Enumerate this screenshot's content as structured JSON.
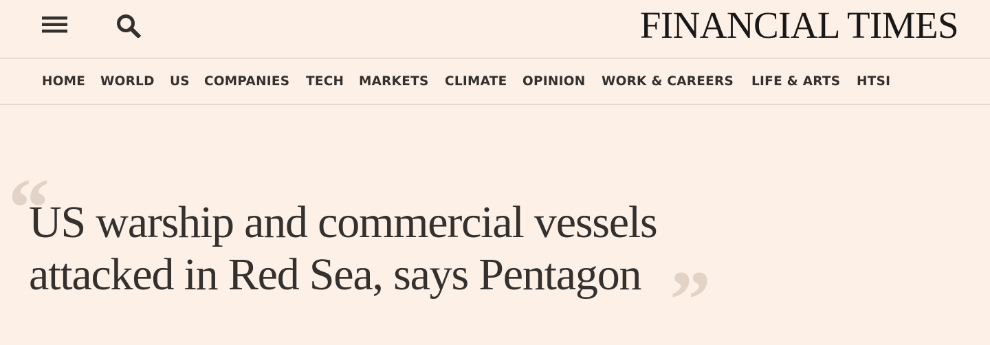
{
  "header": {
    "brand": "FINANCIAL TIMES",
    "menu_icon": "hamburger-menu-icon",
    "search_icon": "search-icon"
  },
  "nav": {
    "items": [
      {
        "label": "HOME"
      },
      {
        "label": "WORLD"
      },
      {
        "label": "US"
      },
      {
        "label": "COMPANIES"
      },
      {
        "label": "TECH"
      },
      {
        "label": "MARKETS"
      },
      {
        "label": "CLIMATE"
      },
      {
        "label": "OPINION"
      },
      {
        "label": "WORK & CAREERS"
      },
      {
        "label": "LIFE & ARTS"
      },
      {
        "label": "HTSI"
      }
    ]
  },
  "main": {
    "quote_open": "“",
    "quote_close": "”",
    "headline": "US warship and commercial vessels attacked in Red Sea, says Pentagon"
  },
  "colors": {
    "background": "#FDF0E6",
    "text": "#33302E",
    "divider": "#CCC1B7",
    "quote_mark": "#E3D3C6"
  }
}
